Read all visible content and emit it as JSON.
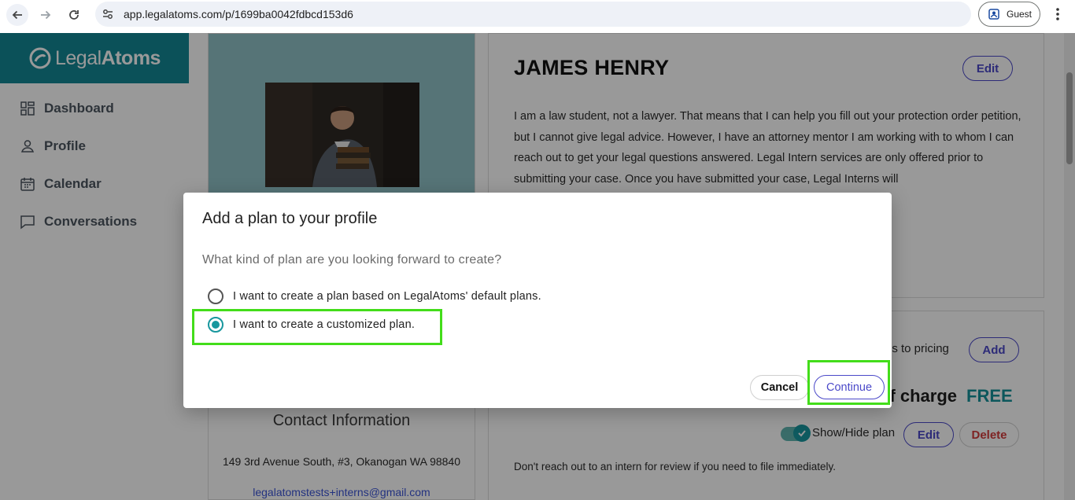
{
  "browser": {
    "url": "app.legalatoms.com/p/1699ba0042fdbcd153d6",
    "profile_label": "Guest"
  },
  "brand": {
    "name_part1": "Legal",
    "name_part2": "Atoms",
    "color": "#138894"
  },
  "sidebar": {
    "items": [
      {
        "label": "Dashboard",
        "icon": "dashboard-icon"
      },
      {
        "label": "Profile",
        "icon": "person-icon"
      },
      {
        "label": "Calendar",
        "icon": "calendar-icon"
      },
      {
        "label": "Conversations",
        "icon": "chat-icon"
      }
    ]
  },
  "profile": {
    "name": "JAMES HENRY",
    "edit_label": "Edit",
    "bio": "I am a law student, not a lawyer. That means that I can help you fill out your protection order petition, but I cannot give legal advice. However, I have an attorney mentor I am working with to whom I can reach out to get your legal questions answered. Legal Intern services are only offered prior to submitting your case. Once you have submitted your case, Legal Interns will",
    "contact_title": "Contact Information",
    "address": "149 3rd Avenue South, #3, Okanogan WA 98840",
    "email": "legalatomstests+interns@gmail.com"
  },
  "plans": {
    "pricing_text": "es to pricing",
    "add_label": "Add",
    "price_label": "of charge",
    "price_value": "FREE",
    "show_hide_label": "Show/Hide plan",
    "edit_label": "Edit",
    "delete_label": "Delete",
    "note": "Don't reach out to an intern for review if you need to file immediately."
  },
  "modal": {
    "title": "Add a plan to your profile",
    "question": "What kind of plan are you looking forward to create?",
    "options": [
      {
        "label": "I want to create a plan based on LegalAtoms' default plans.",
        "checked": false
      },
      {
        "label": "I want to create a customized plan.",
        "checked": true
      }
    ],
    "cancel_label": "Cancel",
    "continue_label": "Continue"
  },
  "colors": {
    "accent": "#18979e",
    "primary_button": "#4b49c9",
    "highlight": "#43dd1a",
    "danger": "#d33b3b"
  }
}
